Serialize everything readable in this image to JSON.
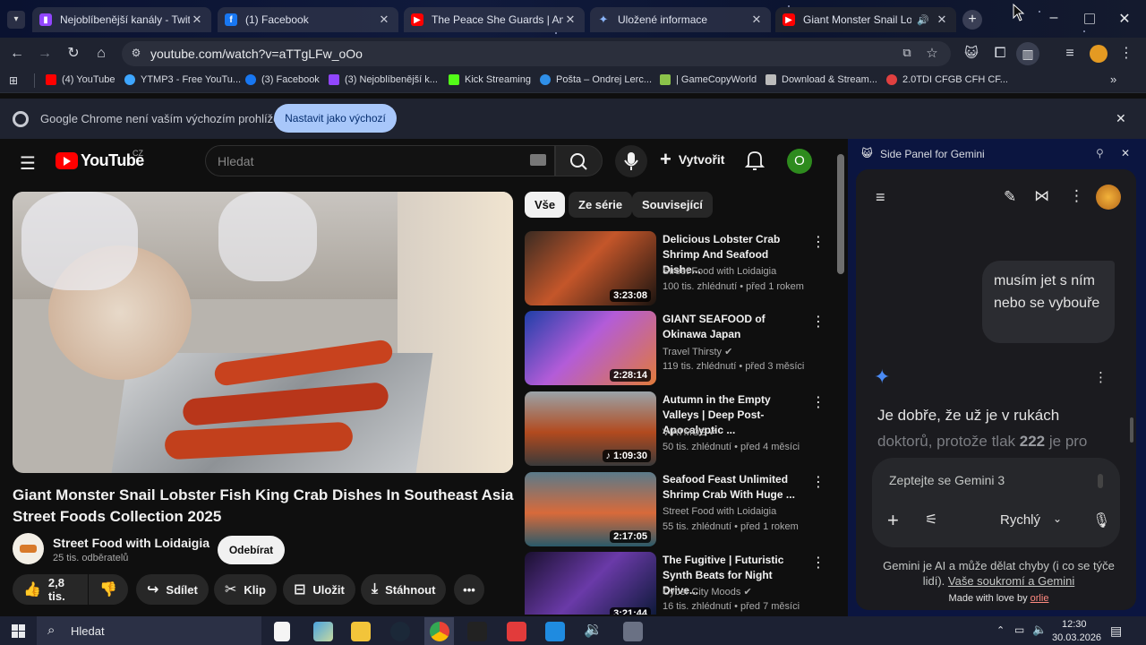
{
  "browser": {
    "tabs": [
      {
        "title": "Nejoblíbenější kanály - Twitch",
        "icon": "twitch-icon",
        "color": "#9146ff"
      },
      {
        "title": "(1) Facebook",
        "icon": "facebook-icon",
        "color": "#1877f2"
      },
      {
        "title": "The Peace She Guards | Ambien",
        "icon": "youtube-icon",
        "color": "#ff0000"
      },
      {
        "title": "Uložené informace",
        "icon": "gemini-icon",
        "color": "#8ab4f8"
      },
      {
        "title": "Giant Monster Snail Lobster",
        "icon": "youtube-icon",
        "color": "#ff0000",
        "active": true
      }
    ],
    "url": "youtube.com/watch?v=aTTgLFw_oOo",
    "bookmarks": [
      {
        "label": "(4) YouTube",
        "color": "#ff0000"
      },
      {
        "label": "YTMP3 - Free YouTu...",
        "color": "#3ea6ff"
      },
      {
        "label": "(3) Facebook",
        "color": "#1877f2"
      },
      {
        "label": "(3) Nejoblíbenější k...",
        "color": "#9146ff"
      },
      {
        "label": "Kick Streaming",
        "color": "#53fc18"
      },
      {
        "label": "Pošta – Ondrej Lerc...",
        "color": "#2f8fe8"
      },
      {
        "label": "| GameCopyWorld",
        "color": "#8bc34a"
      },
      {
        "label": "Download & Stream...",
        "color": "#bbbbbb"
      },
      {
        "label": "2.0TDI CFGB CFH CF...",
        "color": "#e04040"
      }
    ],
    "infobar": {
      "text": "Google Chrome není vaším výchozím prohlížečem",
      "button": "Nastavit jako výchozí"
    }
  },
  "youtube": {
    "logo": "YouTube",
    "region": "CZ",
    "search_placeholder": "Hledat",
    "create_label": "Vytvořit",
    "avatar_letter": "O",
    "video": {
      "title": "Giant Monster Snail Lobster Fish King Crab Dishes In Southeast Asia Street Foods Collection 2025",
      "channel": "Street Food with Loidaigia",
      "subscribers": "25 tis. odběratelů",
      "subscribe": "Odebírat",
      "likes": "2,8 tis.",
      "share": "Sdílet",
      "clip": "Klip",
      "save": "Uložit",
      "download": "Stáhnout"
    },
    "chips": [
      "Vše",
      "Ze série",
      "Související"
    ],
    "recommendations": [
      {
        "title": "Delicious Lobster Crab Shrimp And Seafood Dishe...",
        "channel": "Street Food with Loidaigia",
        "meta": "100 tis. zhlédnutí • před 1 rokem",
        "duration": "3:23:08",
        "verified": false
      },
      {
        "title": "GIANT SEAFOOD of Okinawa Japan",
        "channel": "Travel Thirsty",
        "meta": "119 tis. zhlédnutí • před 3 měsíci",
        "duration": "2:28:14",
        "verified": true
      },
      {
        "title": "Autumn in the Empty Valleys | Deep Post-Apocalyptic ...",
        "channel": "VIATMOS",
        "meta": "50 tis. zhlédnutí • před 4 měsíci",
        "duration": "1:09:30",
        "verified": true
      },
      {
        "title": "Seafood Feast Unlimited Shrimp Crab With Huge ...",
        "channel": "Street Food with Loidaigia",
        "meta": "55 tis. zhlédnutí • před 1 rokem",
        "duration": "2:17:05",
        "verified": false
      },
      {
        "title": "The Fugitive | Futuristic Synth Beats for Night Drive...",
        "channel": "Cyber City Moods",
        "meta": "16 tis. zhlédnutí • před 7 měsíci",
        "duration": "3:21:44",
        "verified": true
      }
    ]
  },
  "gemini": {
    "panel_title": "Side Panel for Gemini",
    "user_message": "musím jet s ním nebo se vybouře",
    "reply_line1": "Je dobře, že už je v rukách",
    "reply_line2a": "doktorů, protože tlak ",
    "reply_line2b": "222",
    "reply_line2c": " je pro",
    "input_placeholder": "Zeptejte se Gemini 3",
    "mode": "Rychlý",
    "disclaimer1": "Gemini je AI a může dělat chyby (i co se týče",
    "disclaimer2a": "lidí). ",
    "disclaimer2b": "Vaše soukromí a Gemini",
    "made_with": "Made with love by ",
    "made_with_author": "orlie"
  },
  "taskbar": {
    "search_placeholder": "Hledat",
    "time": "12:30",
    "date": "30.03.2026"
  }
}
